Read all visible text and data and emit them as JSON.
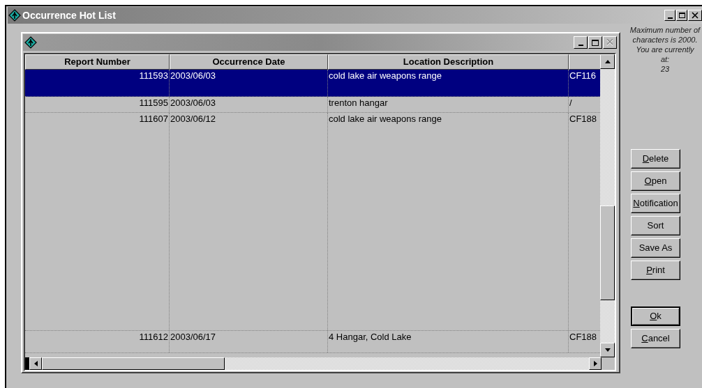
{
  "window": {
    "title": "Occurrence Hot List"
  },
  "table": {
    "columns": [
      "Report Number",
      "Occurrence Date",
      "Location Description"
    ],
    "rows": [
      {
        "selected": true,
        "cells": [
          "111593",
          "2003/06/03",
          "cold lake air weapons range",
          "CF116"
        ]
      },
      {
        "selected": false,
        "cells": [
          "111595",
          "2003/06/03",
          "trenton hangar",
          "/"
        ]
      },
      {
        "selected": false,
        "cells": [
          "111607",
          "2003/06/12",
          "cold lake air weapons range",
          "CF188"
        ]
      },
      {
        "selected": false,
        "cells": [
          "111612",
          "2003/06/17",
          "4 Hangar, Cold Lake",
          "CF188"
        ]
      }
    ]
  },
  "info_text": [
    "Maximum number of",
    "characters is 2000.",
    "You are currently",
    "at:",
    "23"
  ],
  "buttons": [
    {
      "label": "Delete",
      "underlined_initial": true,
      "default": false
    },
    {
      "label": "Open",
      "underlined_initial": true,
      "default": false
    },
    {
      "label": "Notification",
      "underlined_initial": true,
      "default": false
    },
    {
      "label": "Sort",
      "underlined_initial": false,
      "default": false
    },
    {
      "label": "Save As",
      "underlined_initial": false,
      "default": false
    },
    {
      "label": "Print",
      "underlined_initial": true,
      "default": false
    }
  ],
  "dialog_buttons": [
    {
      "label": "Ok",
      "underlined_initial": true,
      "default": true
    },
    {
      "label": "Cancel",
      "underlined_initial": true,
      "default": false
    }
  ]
}
